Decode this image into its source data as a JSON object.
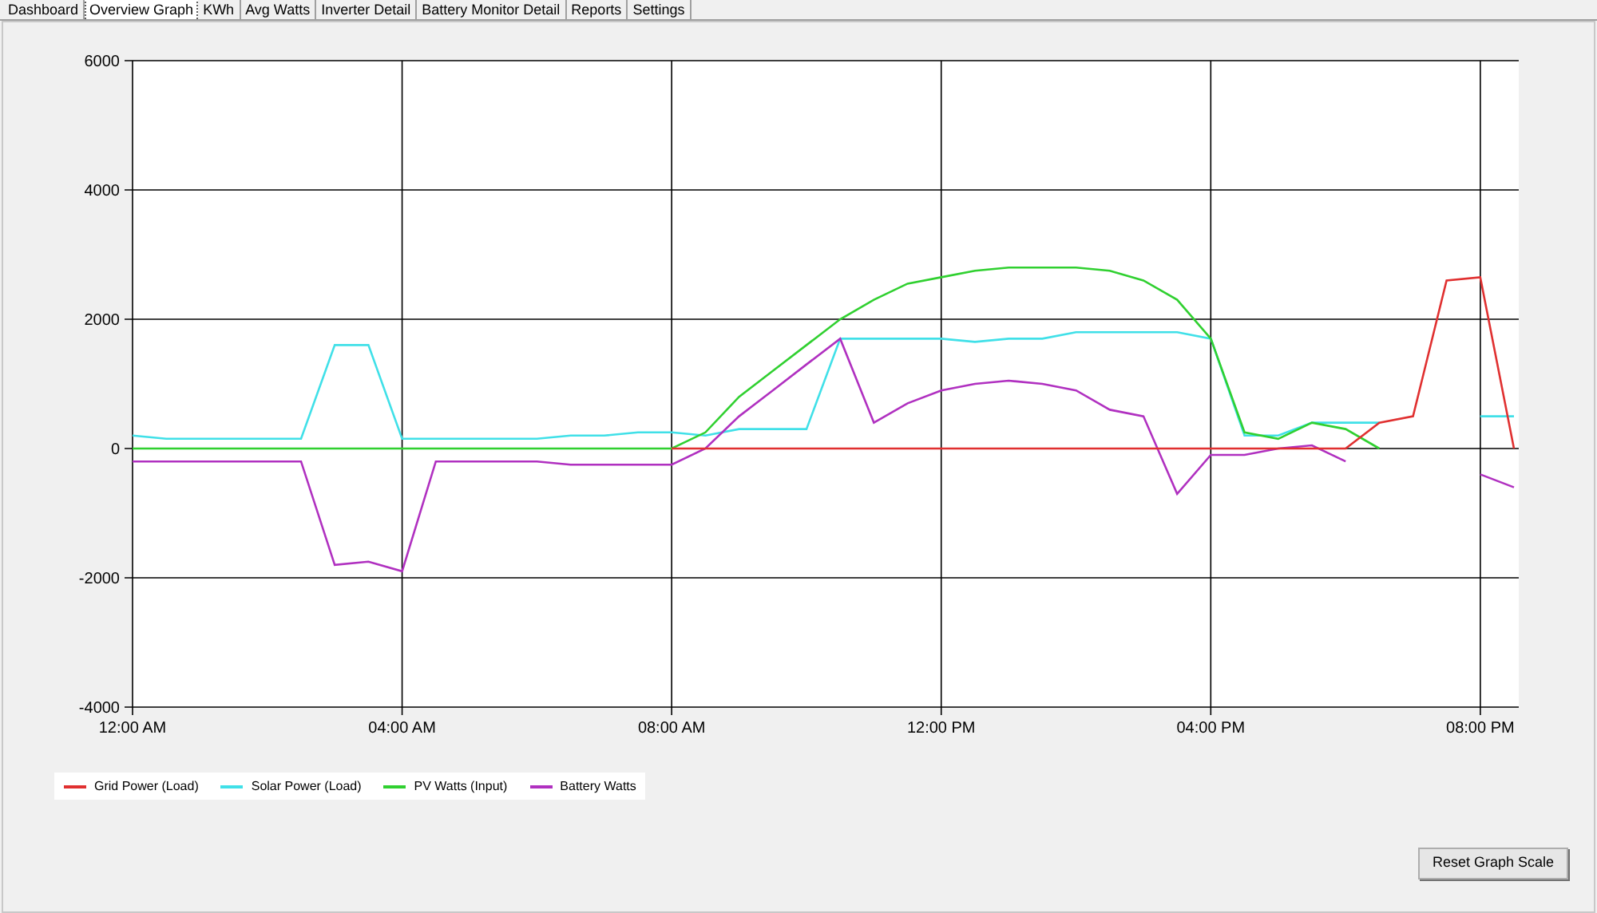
{
  "tabs": [
    {
      "label": "Dashboard",
      "selected": false
    },
    {
      "label": "Overview Graph",
      "selected": true
    },
    {
      "label": "KWh",
      "selected": false
    },
    {
      "label": "Avg Watts",
      "selected": false
    },
    {
      "label": "Inverter Detail",
      "selected": false
    },
    {
      "label": "Battery Monitor Detail",
      "selected": false
    },
    {
      "label": "Reports",
      "selected": false
    },
    {
      "label": "Settings",
      "selected": false
    }
  ],
  "chart_data": {
    "type": "line",
    "x": [
      0,
      0.5,
      1,
      1.5,
      2,
      2.5,
      3,
      3.5,
      4,
      4.5,
      5,
      5.5,
      6,
      6.5,
      7,
      7.5,
      8,
      8.5,
      9,
      9.5,
      10,
      10.5,
      11,
      11.5,
      12,
      12.5,
      13,
      13.5,
      14,
      14.5,
      15,
      15.5,
      16,
      16.5,
      17,
      17.5,
      18,
      18.5,
      19,
      19.5,
      20,
      20.5
    ],
    "xlim": [
      0,
      20.57
    ],
    "ylim": [
      -4000,
      6000
    ],
    "xticks": [
      {
        "value": 0,
        "label": "12:00 AM"
      },
      {
        "value": 4,
        "label": "04:00 AM"
      },
      {
        "value": 8,
        "label": "08:00 AM"
      },
      {
        "value": 12,
        "label": "12:00 PM"
      },
      {
        "value": 16,
        "label": "04:00 PM"
      },
      {
        "value": 20,
        "label": "08:00 PM"
      }
    ],
    "yticks": [
      -4000,
      -2000,
      0,
      2000,
      4000,
      6000
    ],
    "grid": true,
    "series": [
      {
        "name": "Grid Power (Load)",
        "color": "#e03030",
        "values": [
          null,
          null,
          null,
          null,
          null,
          null,
          null,
          null,
          null,
          null,
          null,
          null,
          null,
          null,
          null,
          null,
          0,
          0,
          0,
          0,
          0,
          0,
          0,
          0,
          0,
          0,
          0,
          0,
          0,
          0,
          0,
          0,
          0,
          0,
          0,
          0,
          0,
          400,
          500,
          2600,
          2650,
          0
        ]
      },
      {
        "name": "Solar Power (Load)",
        "color": "#40e0e8",
        "values": [
          200,
          150,
          150,
          150,
          150,
          150,
          1600,
          1600,
          150,
          150,
          150,
          150,
          150,
          200,
          200,
          250,
          250,
          200,
          300,
          300,
          300,
          1700,
          1700,
          1700,
          1700,
          1650,
          1700,
          1700,
          1800,
          1800,
          1800,
          1800,
          1700,
          200,
          200,
          400,
          400,
          400,
          null,
          null,
          500,
          500
        ]
      },
      {
        "name": "PV Watts (Input)",
        "color": "#30d030",
        "values": [
          0,
          0,
          0,
          0,
          0,
          0,
          0,
          0,
          0,
          0,
          0,
          0,
          0,
          0,
          0,
          0,
          0,
          250,
          800,
          1200,
          1600,
          2000,
          2300,
          2550,
          2650,
          2750,
          2800,
          2800,
          2800,
          2750,
          2600,
          2300,
          1700,
          250,
          150,
          400,
          300,
          0,
          null,
          null,
          null,
          null
        ]
      },
      {
        "name": "Battery Watts",
        "color": "#b030c0",
        "values": [
          -200,
          -200,
          -200,
          -200,
          -200,
          -200,
          -1800,
          -1750,
          -1900,
          -200,
          -200,
          -200,
          -200,
          -250,
          -250,
          -250,
          -250,
          0,
          500,
          900,
          1300,
          1700,
          400,
          700,
          900,
          1000,
          1050,
          1000,
          900,
          600,
          500,
          -700,
          -100,
          -100,
          0,
          50,
          -200,
          null,
          null,
          null,
          -400,
          -600
        ]
      }
    ]
  },
  "reset_button": "Reset Graph Scale"
}
